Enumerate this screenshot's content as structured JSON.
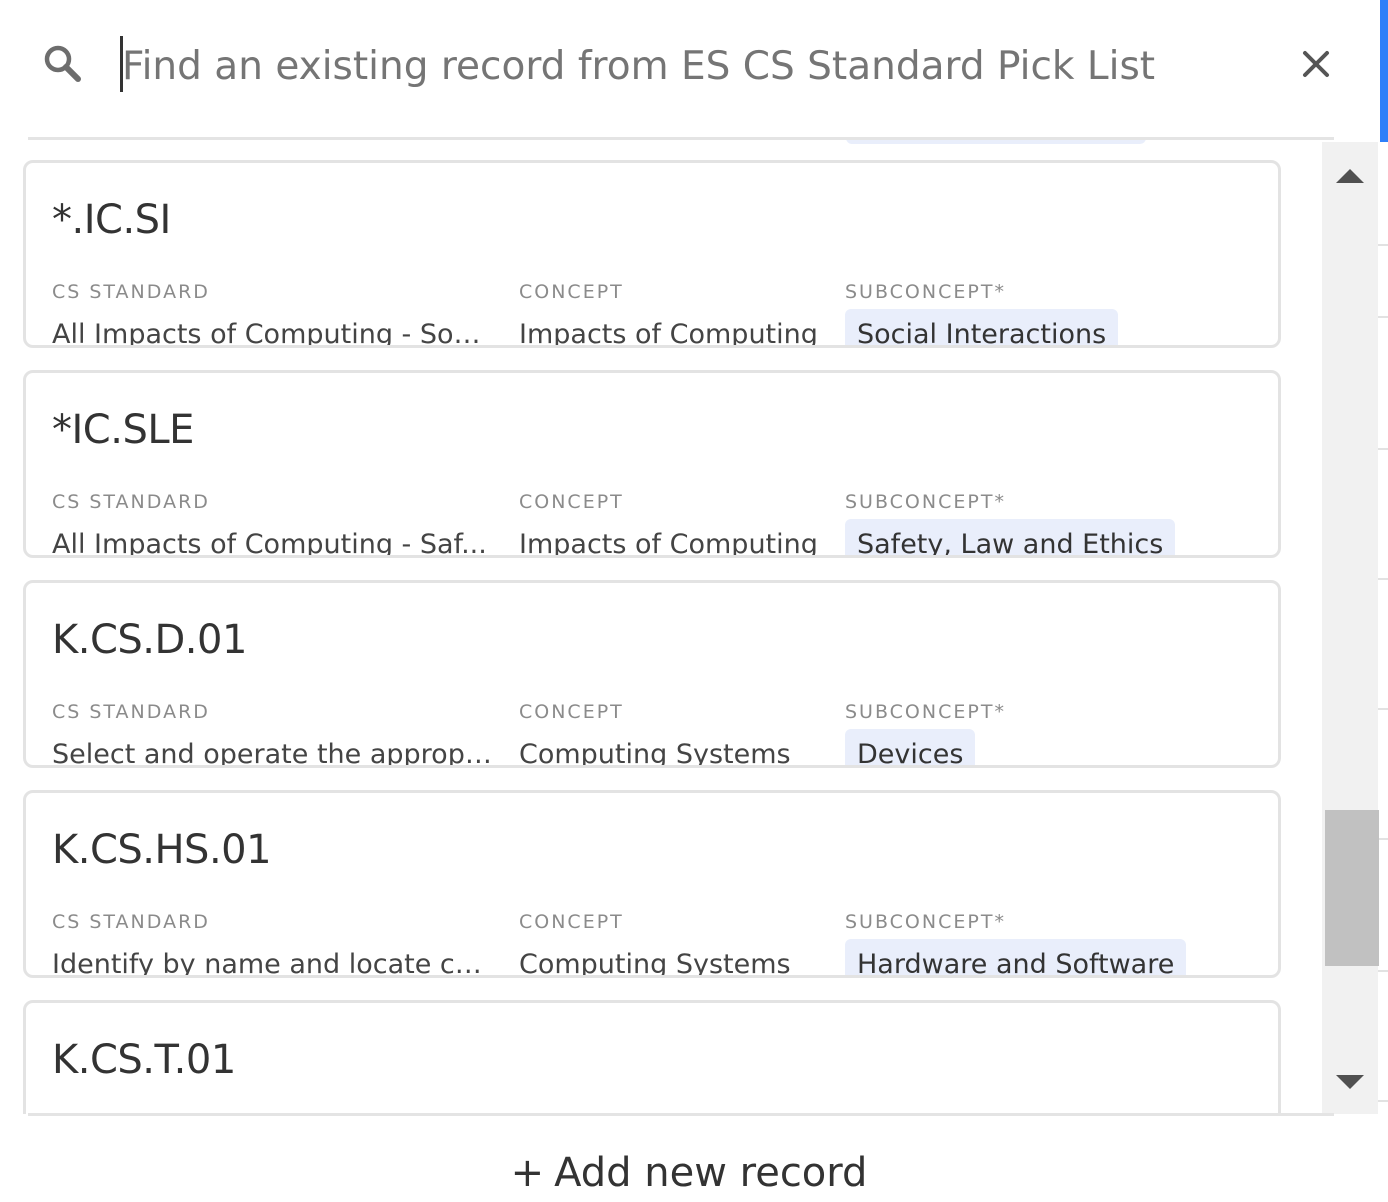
{
  "search": {
    "placeholder": "Find an existing record from ES CS Standard Pick List",
    "value": ""
  },
  "icons": {
    "search": "search-icon",
    "close": "close-icon",
    "scroll_up": "triangle-up-icon",
    "scroll_down": "triangle-down-icon",
    "add": "plus-icon"
  },
  "colors": {
    "pill_background": "#e9eefb",
    "accent": "#2d7ff9",
    "card_border": "#e3e3e3"
  },
  "field_labels": {
    "cs_standard": "CS STANDARD",
    "concept": "CONCEPT",
    "subconcept": "SUBCONCEPT*"
  },
  "records": [
    {
      "title": "*.IC.SI",
      "cs_standard": "All Impacts of Computing - Soc...",
      "concept": "Impacts of Computing",
      "subconcept": "Social Interactions"
    },
    {
      "title": "*IC.SLE",
      "cs_standard": "All Impacts of Computing - Saf...",
      "concept": "Impacts of Computing",
      "subconcept": "Safety, Law and Ethics"
    },
    {
      "title": "K.CS.D.01",
      "cs_standard": "Select and operate the appropr...",
      "concept": "Computing Systems",
      "subconcept": "Devices"
    },
    {
      "title": "K.CS.HS.01",
      "cs_standard": "Identify by name and locate co...",
      "concept": "Computing Systems",
      "subconcept": "Hardware and Software"
    },
    {
      "title": "K.CS.T.01"
    }
  ],
  "add_record": {
    "plus": "+",
    "label": "Add new record"
  }
}
